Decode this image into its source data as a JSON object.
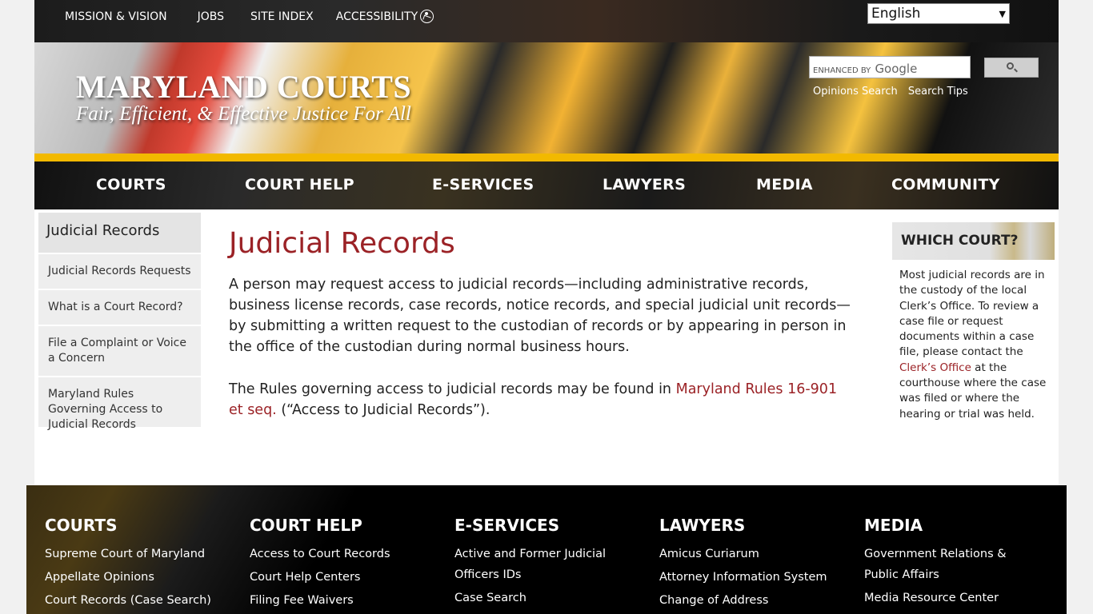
{
  "top_links": [
    "MISSION & VISION",
    "JOBS",
    "SITE INDEX",
    "ACCESSIBILITY"
  ],
  "language": {
    "selected": "English"
  },
  "logo": {
    "title": "MARYLAND COURTS",
    "tagline": "Fair, Efficient, & Effective Justice For All"
  },
  "search": {
    "prefix": "ENHANCED BY",
    "brand": "Google",
    "links": [
      "Opinions Search",
      "Search Tips"
    ]
  },
  "main_nav": [
    "COURTS",
    "COURT HELP",
    "E-SERVICES",
    "LAWYERS",
    "MEDIA",
    "COMMUNITY"
  ],
  "sidebar": {
    "heading": "Judicial Records",
    "items": [
      "Judicial Records Requests",
      "What is a Court Record?",
      "File a Complaint or Voice a Concern",
      "Maryland Rules Governing Access to Judicial Records"
    ]
  },
  "content": {
    "title": "Judicial Records",
    "paragraph1": "A person may request access to judicial records—including administrative records, business license records, case records, notice records, and special judicial unit records—by submitting a written request to the custodian of records or by appearing in person in the office of the custodian during normal business hours.",
    "p2_before": "The Rules governing access to judicial records may be found in ",
    "p2_link": "Maryland Rules 16-901 et seq.",
    "p2_after": " (“Access to Judicial Records”)."
  },
  "aside": {
    "heading": "WHICH COURT?",
    "text_before": "Most judicial records are in the custody of the local Clerk’s Office. To review a case file or request documents within a case file, please contact the ",
    "link": "Clerk’s Office",
    "text_after": " at the courthouse where the case was filed or where the hearing or trial was held."
  },
  "footer": {
    "columns": [
      {
        "heading": "COURTS",
        "links": [
          "Supreme Court of Maryland",
          "Appellate Opinions",
          "Court Records (Case Search)"
        ]
      },
      {
        "heading": "COURT HELP",
        "links": [
          "Access to Court Records",
          "Court Help Centers",
          "Filing Fee Waivers"
        ]
      },
      {
        "heading": "E-SERVICES",
        "links": [
          "Active and Former Judicial Officers IDs",
          "Case Search"
        ]
      },
      {
        "heading": "LAWYERS",
        "links": [
          "Amicus Curiarum",
          "Attorney Information System",
          "Change of Address"
        ]
      },
      {
        "heading": "MEDIA",
        "links": [
          "Government Relations & Public Affairs",
          "Media Resource Center"
        ]
      }
    ]
  },
  "colors": {
    "accent_red": "#9b2226",
    "gold": "#f2b900"
  }
}
